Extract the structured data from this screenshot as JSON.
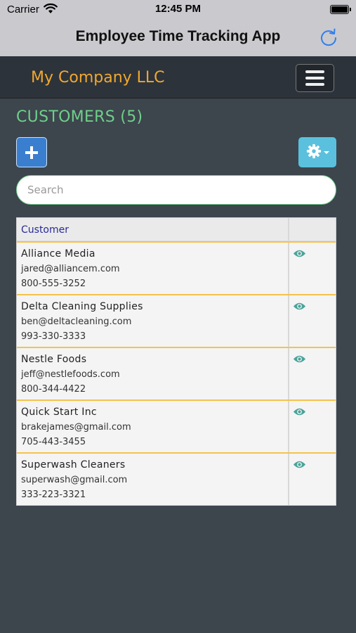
{
  "status_bar": {
    "carrier": "Carrier",
    "time": "12:45 PM"
  },
  "nav_bar": {
    "title": "Employee Time Tracking App"
  },
  "header": {
    "company": "My Company LLC"
  },
  "section": {
    "title": "CUSTOMERS (5)"
  },
  "search": {
    "placeholder": "Search",
    "value": ""
  },
  "table": {
    "column_header": "Customer",
    "rows": [
      {
        "name": "Alliance Media",
        "email": "jared@alliancem.com",
        "phone": "800-555-3252"
      },
      {
        "name": "Delta Cleaning Supplies",
        "email": "ben@deltacleaning.com",
        "phone": "993-330-3333"
      },
      {
        "name": "Nestle Foods",
        "email": "jeff@nestlefoods.com",
        "phone": "800-344-4422"
      },
      {
        "name": "Quick Start Inc",
        "email": "brakejames@gmail.com",
        "phone": "705-443-3455"
      },
      {
        "name": "Superwash Cleaners",
        "email": "superwash@gmail.com",
        "phone": "333-223-3321"
      }
    ]
  },
  "icons": {
    "wifi": "wifi-icon",
    "battery": "battery-icon",
    "refresh": "refresh-icon",
    "menu": "hamburger-menu-icon",
    "add": "plus-icon",
    "settings": "gear-icon",
    "view": "eye-icon"
  },
  "colors": {
    "company": "#f0a830",
    "section_title": "#6fcf8a",
    "add_button": "#3a7fcf",
    "settings_button": "#5bc0de",
    "row_separator": "#f5c34b",
    "eye": "#4aa39a",
    "refresh": "#2f7ff0"
  }
}
